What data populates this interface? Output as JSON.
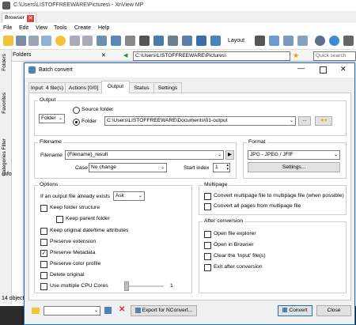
{
  "app": {
    "title": "C:\\Users\\LISTOFFREEWARE\\Pictures\\ - XnView MP",
    "tab_browser": "Browser",
    "menu": [
      "File",
      "Edit",
      "View",
      "Tools",
      "Create",
      "Help"
    ],
    "layout_label": "Layout",
    "folders_panel": "Folders",
    "address": "C:\\Users\\LISTOFFREEWARE\\Pictures\\",
    "quick_search_placeholder": "Quick search",
    "rail_tabs": [
      "Folders",
      "Favorites",
      "Categories Filter"
    ],
    "info_label": "Info",
    "status": "14 objects"
  },
  "dialog": {
    "title": "Batch convert",
    "tabs": [
      "Input: 4 file(s)",
      "Actions [0/0]",
      "Output",
      "Status",
      "Settings"
    ],
    "output": {
      "group": "Output",
      "folder_combo": "Folder",
      "source_folder": "Source folder",
      "folder_label": "Folder",
      "folder_path": "C:\\Users\\LISTOFFREEWARE\\Documents\\01-output",
      "browse": "..."
    },
    "filename": {
      "group": "Filename",
      "label": "Filename",
      "value": "{Filename}_result",
      "case_label": "Case",
      "case_value": "No change",
      "start_index_label": "Start index",
      "start_index_value": "1"
    },
    "format": {
      "group": "Format",
      "value": "JPG - JPEG / JFIF",
      "settings": "Settings..."
    },
    "options": {
      "group": "Options",
      "exists_label": "If an output file already exists",
      "exists_value": "Ask",
      "keep_folder_structure": "Keep folder structure",
      "keep_parent_folder": "Keep parent folder",
      "keep_date": "Keep original date/time attributes",
      "preserve_extension": "Preserve extension",
      "preserve_metadata": "Preserve Metadata",
      "preserve_color": "Preserve color profile",
      "delete_original": "Delete original",
      "multiple_cpu": "Use multiple CPU Cores",
      "cpu_count": "1"
    },
    "multipage": {
      "group": "Multipage",
      "convert_multipage": "Convert multipage file to multipage file (when possible)",
      "convert_all_pages": "Convert all pages from multipage file"
    },
    "after": {
      "group": "After conversion",
      "open_explorer": "Open file explorer",
      "open_browser": "Open in Browser",
      "clear_input": "Clear the 'Input' file(s)",
      "exit_after": "Exit after conversion"
    },
    "footer": {
      "export": "Export for NConvert...",
      "convert": "Convert",
      "close": "Close"
    },
    "colors": {
      "accent": "#1f6fb3",
      "folder_yellow": "#f3c23b",
      "delete_red": "#d42c2c"
    }
  }
}
